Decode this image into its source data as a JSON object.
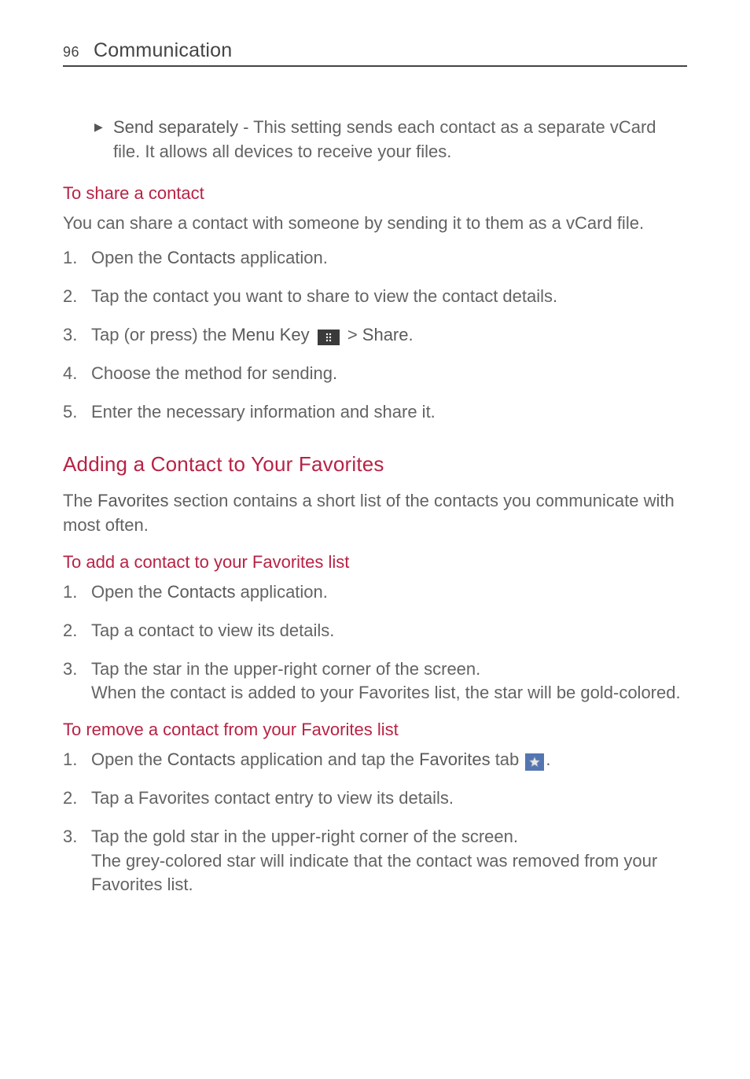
{
  "header": {
    "page_number": "96",
    "section": "Communication"
  },
  "bullet": {
    "label": "Send separately",
    "desc": " - This setting sends each contact as a separate vCard file. It allows all devices to receive your files."
  },
  "share": {
    "heading": "To share a contact",
    "intro": "You can share a contact with someone by sending it to them as a vCard file.",
    "s1a": "Open the ",
    "s1b": "Contacts",
    "s1c": " application.",
    "s2": "Tap the contact you want to share to view the contact details.",
    "s3a": "Tap (or press) the ",
    "s3b": "Menu Key",
    "s3gt": " > ",
    "s3c": "Share",
    "s3d": ".",
    "s4": "Choose the method for sending.",
    "s5": "Enter the necessary information and share it."
  },
  "favorites": {
    "main_heading": "Adding a Contact to Your Favorites",
    "intro_a": "The ",
    "intro_b": "Favorites",
    "intro_c": " section contains a short list of the contacts you communicate with most often."
  },
  "add_fav": {
    "heading": "To add a contact to your Favorites list",
    "s1a": "Open the ",
    "s1b": "Contacts",
    "s1c": " application.",
    "s2": "Tap a contact to view its details.",
    "s3a": "Tap the star in the upper-right corner of the screen.",
    "s3b": "When the contact is added to your Favorites list, the star will be gold-colored."
  },
  "remove_fav": {
    "heading": "To remove a contact from your Favorites list",
    "s1a": "Open the ",
    "s1b": "Contacts",
    "s1c": " application and tap the ",
    "s1d": "Favorites",
    "s1e": " tab ",
    "s1f": ".",
    "s2": "Tap a Favorites contact entry to view its details.",
    "s3a": "Tap the gold star in the upper-right corner of the screen.",
    "s3b": "The grey-colored star will indicate that the contact was removed from your Favorites list."
  }
}
